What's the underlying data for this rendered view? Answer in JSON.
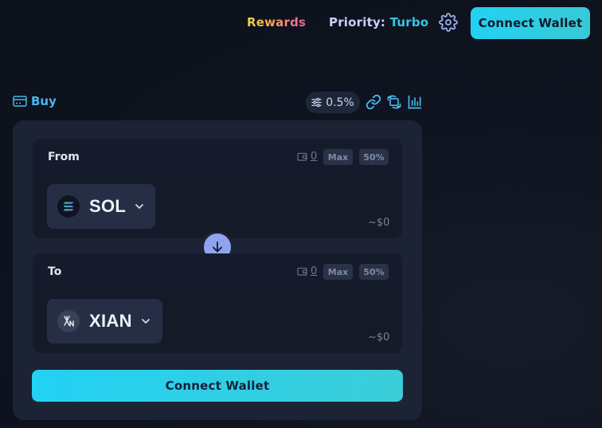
{
  "header": {
    "rewards": "Rewards",
    "priority_label": "Priority:",
    "priority_value": "Turbo",
    "connect_wallet": "Connect Wallet"
  },
  "toolbar": {
    "buy_label": "Buy",
    "slippage": "0.5%"
  },
  "from": {
    "label": "From",
    "balance": "0",
    "max": "Max",
    "half": "50%",
    "token": "SOL",
    "usd_value": "~$0"
  },
  "to": {
    "label": "To",
    "balance": "0",
    "max": "Max",
    "half": "50%",
    "token": "XIAN",
    "usd_value": "~$0"
  },
  "connect_button": "Connect Wallet",
  "colors": {
    "accent": "#22d1f3",
    "link": "#49b8ee",
    "swap_circle": "#8fa4ee",
    "card": "#1c2335"
  },
  "icons": [
    "gear-icon",
    "card-icon",
    "sliders-icon",
    "link-icon",
    "refresh-icon",
    "chart-icon",
    "wallet-icon",
    "chevron-down-icon",
    "arrow-down-icon",
    "sol-icon",
    "xian-icon"
  ]
}
